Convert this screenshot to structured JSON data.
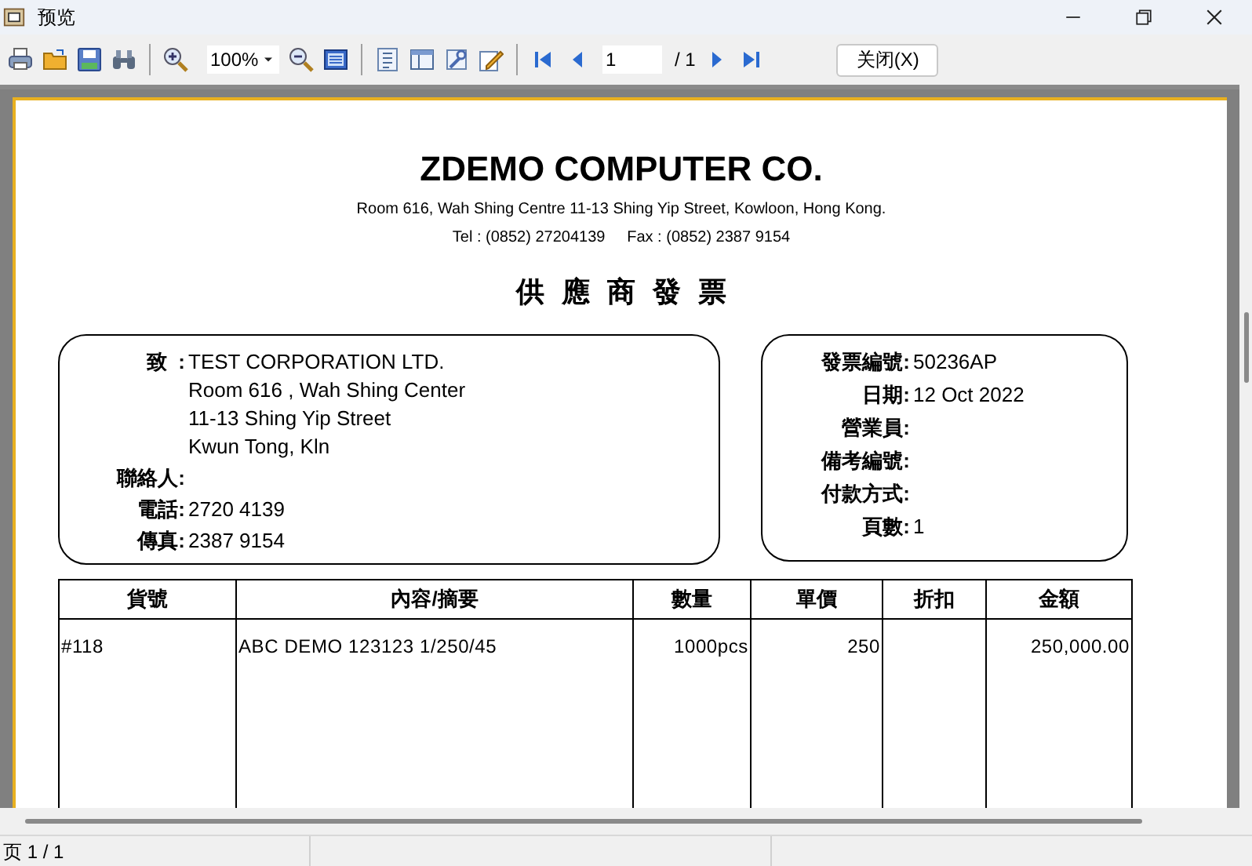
{
  "window": {
    "title": "预览"
  },
  "toolbar": {
    "zoom": "100%",
    "page_input": "1",
    "page_total": "/ 1",
    "close_button": "关闭(X)"
  },
  "document": {
    "company": "ZDEMO COMPUTER CO.",
    "address": "Room 616, Wah Shing Centre 11-13 Shing Yip Street, Kowloon, Hong Kong.",
    "contact": "Tel : (0852) 27204139     Fax : (0852) 2387 9154",
    "title": "供應商發票",
    "recipient": {
      "label": "致  :",
      "lines": [
        "TEST CORPORATION LTD.",
        "Room 616 , Wah Shing Center",
        "11-13 Shing Yip Street",
        "Kwun Tong, Kln"
      ]
    },
    "recipient_fields": [
      {
        "label": "聯絡人:"
      },
      {
        "label": "電話:",
        "value": "2720 4139"
      },
      {
        "label": "傳真:",
        "value": "2387 9154"
      }
    ],
    "invoice_fields": [
      {
        "label": "發票編號:",
        "value": "50236AP"
      },
      {
        "label": "日期:",
        "value": "12 Oct 2022"
      },
      {
        "label": "營業員:"
      },
      {
        "label": "備考編號:"
      },
      {
        "label": "付款方式:"
      },
      {
        "label": "頁數:",
        "value": "1"
      }
    ],
    "table": {
      "columns": [
        {
          "label": "貨號"
        },
        {
          "label": "內容/摘要"
        },
        {
          "label": "數量"
        },
        {
          "label": "單價"
        },
        {
          "label": "折扣"
        },
        {
          "label": "金額"
        }
      ],
      "rows": [
        [
          "#118",
          "ABC DEMO 123123 1/250/45",
          "1000pcs",
          "250",
          null,
          "250,000.00"
        ]
      ]
    }
  },
  "status_bar": {
    "page": "页 1 / 1"
  }
}
